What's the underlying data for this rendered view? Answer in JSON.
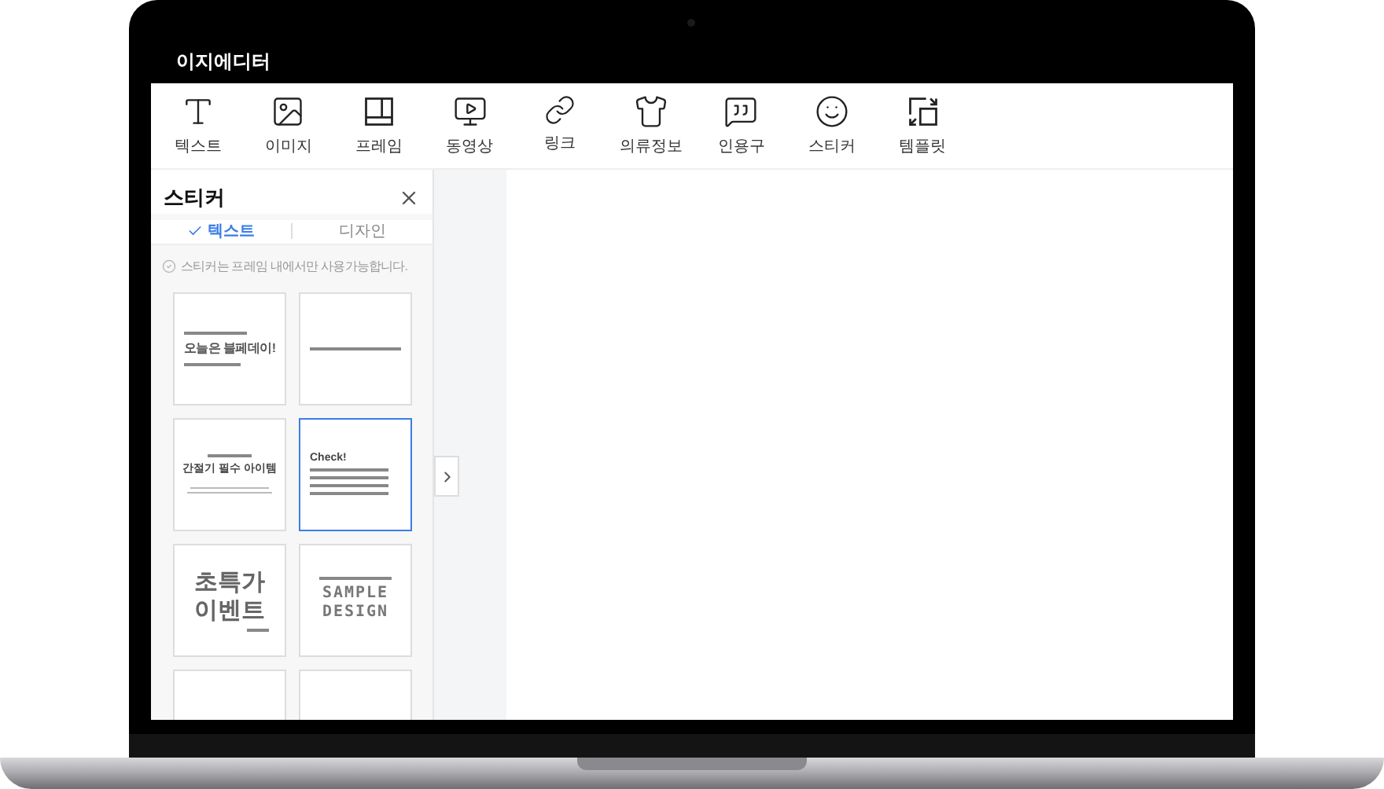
{
  "window": {
    "title": "이지에디터"
  },
  "toolbar": [
    {
      "label": "텍스트"
    },
    {
      "label": "이미지"
    },
    {
      "label": "프레임"
    },
    {
      "label": "동영상"
    },
    {
      "label": "링크"
    },
    {
      "label": "의류정보"
    },
    {
      "label": "인용구"
    },
    {
      "label": "스티커"
    },
    {
      "label": "템플릿"
    }
  ],
  "panel": {
    "title": "스티커",
    "tabs": [
      {
        "label": "텍스트",
        "selected": true
      },
      {
        "label": "디자인",
        "selected": false
      }
    ],
    "notice": "스티커는 프레임 내에서만 사용가능합니다.",
    "stickers": [
      {
        "kind": "headline",
        "heading": "오늘은 블페데이!",
        "selected": false
      },
      {
        "kind": "lines",
        "selected": false
      },
      {
        "kind": "centered",
        "heading": "간절기 필수 아이템",
        "selected": false
      },
      {
        "kind": "checklist",
        "heading": "Check!",
        "selected": true
      },
      {
        "kind": "bold",
        "heading": "초특가 이벤트",
        "selected": false
      },
      {
        "kind": "sample",
        "heading": "SAMPLE DESIGN",
        "selected": false
      },
      {
        "kind": "blank",
        "selected": false
      },
      {
        "kind": "blank",
        "selected": false
      }
    ]
  }
}
